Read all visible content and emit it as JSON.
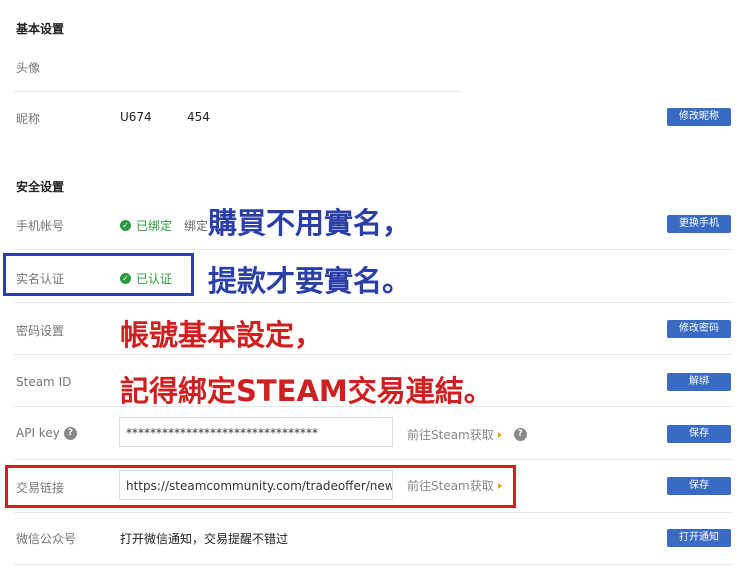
{
  "basic": {
    "title": "基本设置",
    "avatar_label": "头像",
    "nickname_label": "昵称",
    "nickname_value": "U674",
    "nickname_suffix": "454",
    "edit_nickname_btn": "修改昵称"
  },
  "security": {
    "title": "安全设置",
    "phone_label": "手机帐号",
    "phone_status": "已绑定",
    "phone_bind_text": "绑定",
    "phone_masked": "***",
    "change_phone_btn": "更换手机",
    "realname_label": "实名认证",
    "realname_status": "已认证",
    "password_label": "密码设置",
    "change_password_btn": "修改密码",
    "steamid_label": "Steam ID",
    "unbind_btn": "解绑",
    "apikey_label": "API key",
    "apikey_value": "********************************",
    "goto_steam": "前往Steam获取",
    "save_btn": "保存",
    "trade_label": "交易链接",
    "trade_value": "https://steamcommunity.com/tradeoffer/new",
    "save_btn2": "保存",
    "wechat_label": "微信公众号",
    "wechat_text": "打开微信通知，交易提醒不错过",
    "open_notify_btn": "打开通知"
  },
  "annotations": {
    "line1": "購買不用實名，",
    "line2": "提款才要實名。",
    "line3": "帳號基本設定，",
    "line4": "記得綁定STEAM交易連結。"
  },
  "colors": {
    "button": "#3a6bc4",
    "verified": "#2c9a3c",
    "anno_blue": "#2a3fa8",
    "anno_red": "#d01f1f"
  }
}
